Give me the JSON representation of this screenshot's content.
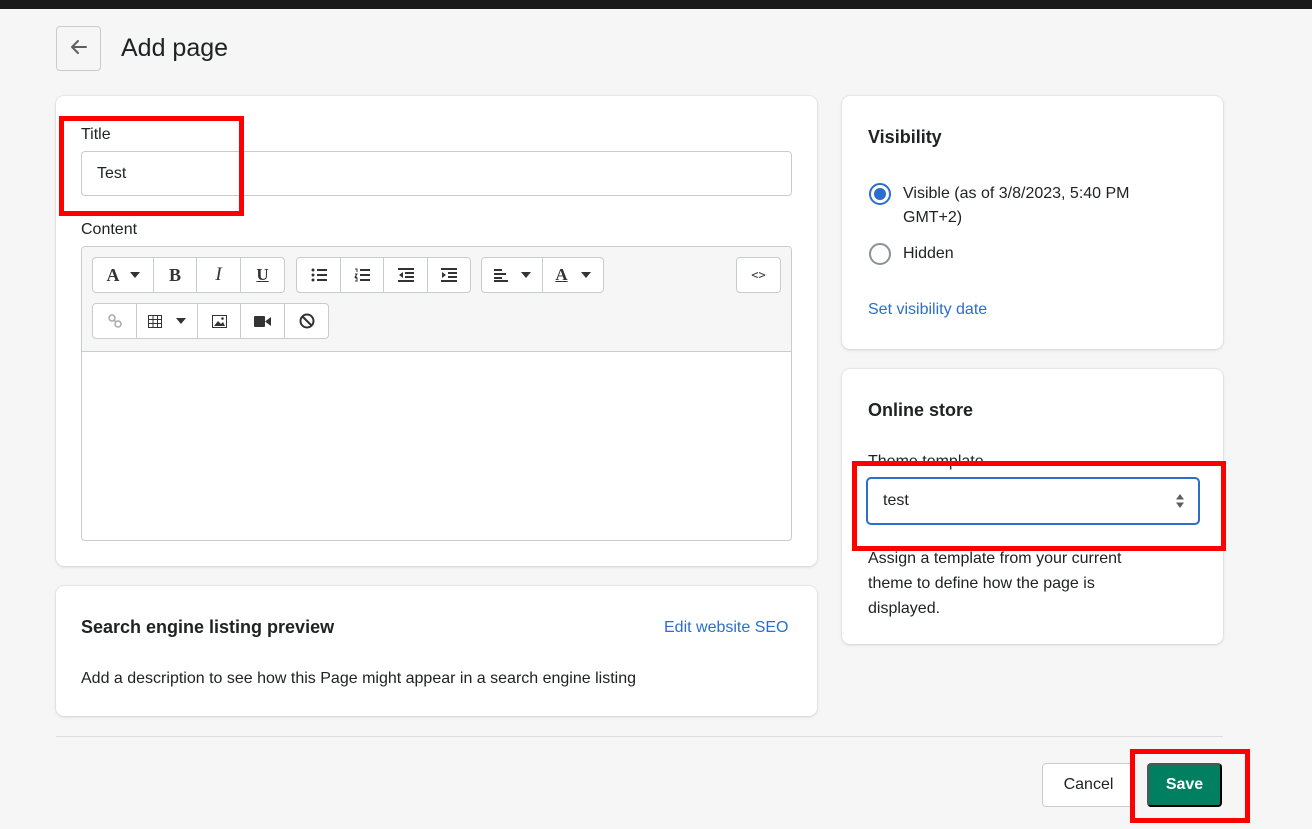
{
  "header": {
    "title": "Add page"
  },
  "main": {
    "title_label": "Title",
    "title_value": "Test",
    "content_label": "Content",
    "toolbar": {
      "row1": [
        "font-icon",
        "bold-icon",
        "italic-icon",
        "underline-icon",
        "bulleted-list-icon",
        "numbered-list-icon",
        "outdent-icon",
        "indent-icon",
        "align-icon",
        "text-color-icon"
      ],
      "row2": [
        "link-icon",
        "table-icon",
        "image-icon",
        "video-icon",
        "clear-format-icon"
      ],
      "html_label": "<>",
      "bold_glyph": "B",
      "italic_glyph": "I",
      "underline_glyph": "U",
      "font_glyph": "A"
    }
  },
  "seo": {
    "heading": "Search engine listing preview",
    "edit_link": "Edit website SEO",
    "description": "Add a description to see how this Page might appear in a search engine listing"
  },
  "visibility": {
    "heading": "Visibility",
    "options": [
      {
        "label": "Visible (as of 3/8/2023, 5:40 PM GMT+2)",
        "selected": true
      },
      {
        "label": "Hidden",
        "selected": false
      }
    ],
    "set_date_link": "Set visibility date"
  },
  "online_store": {
    "heading": "Online store",
    "template_label": "Theme template",
    "template_value": "test",
    "help_text": "Assign a template from your current theme to define how the page is displayed."
  },
  "footer": {
    "cancel_label": "Cancel",
    "save_label": "Save"
  },
  "colors": {
    "primary": "#008060",
    "link": "#2c6ecb",
    "highlight": "#ff0000"
  }
}
